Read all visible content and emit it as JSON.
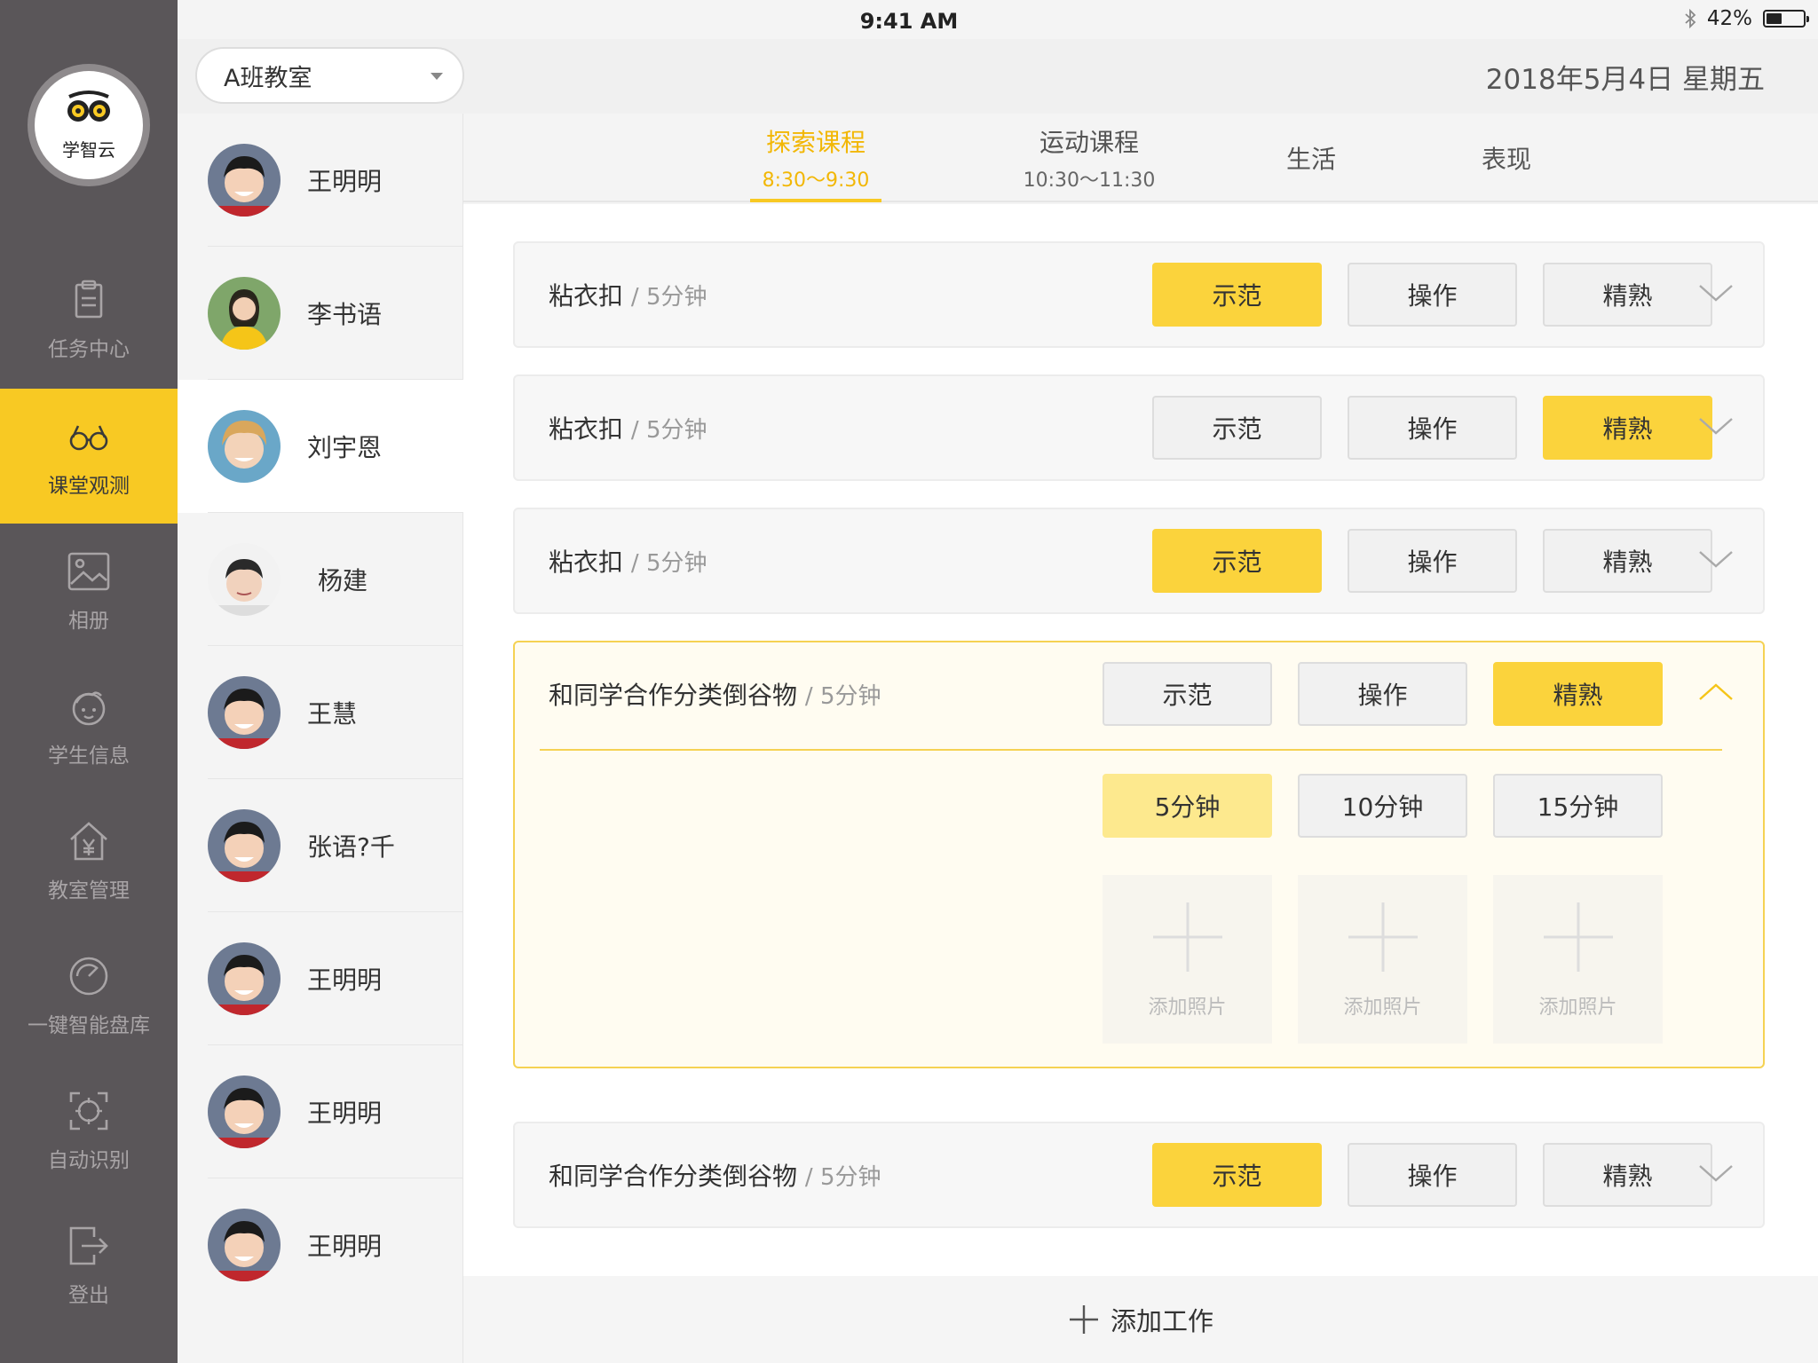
{
  "status_bar": {
    "device": "iPad",
    "time": "9:41 AM",
    "battery": "42%",
    "battery_level": 0.42
  },
  "app": {
    "logo_text": "学智云"
  },
  "nav": [
    {
      "label": "任务中心",
      "icon": "clipboard-icon",
      "active": false
    },
    {
      "label": "课堂观测",
      "icon": "glasses-icon",
      "active": true
    },
    {
      "label": "相册",
      "icon": "photo-icon",
      "active": false
    },
    {
      "label": "学生信息",
      "icon": "child-face-icon",
      "active": false
    },
    {
      "label": "教室管理",
      "icon": "house-yen-icon",
      "active": false
    },
    {
      "label": "一键智能盘库",
      "icon": "gauge-icon",
      "active": false
    },
    {
      "label": "自动识别",
      "icon": "scan-icon",
      "active": false
    },
    {
      "label": "登出",
      "icon": "logout-icon",
      "active": false
    }
  ],
  "header": {
    "classroom": "A班教室",
    "date": "2018年5月4日 星期五"
  },
  "students": [
    {
      "name": "王明明"
    },
    {
      "name": "李书语"
    },
    {
      "name": "刘宇恩"
    },
    {
      "name": "杨建"
    },
    {
      "name": "王慧"
    },
    {
      "name": "张语?千"
    },
    {
      "name": "王明明"
    },
    {
      "name": "王明明"
    },
    {
      "name": "王明明"
    }
  ],
  "tabs": [
    {
      "label": "探索课程",
      "time": "8:30～9:30",
      "active": true
    },
    {
      "label": "运动课程",
      "time": "10:30～11:30",
      "active": false
    },
    {
      "label": "生活",
      "time": "",
      "active": false
    },
    {
      "label": "表现",
      "time": "",
      "active": false
    }
  ],
  "levels": [
    "示范",
    "操作",
    "精熟"
  ],
  "activities": [
    {
      "name": "粘衣扣",
      "duration": "/ 5分钟",
      "selected": "示范"
    },
    {
      "name": "粘衣扣",
      "duration": "/ 5分钟",
      "selected": "精熟"
    },
    {
      "name": "粘衣扣",
      "duration": "/ 5分钟",
      "selected": "示范"
    },
    {
      "name": "和同学合作分类倒谷物",
      "duration": "/ 5分钟",
      "selected": "精熟",
      "expanded": true,
      "duration_options": [
        "5分钟",
        "10分钟",
        "15分钟"
      ],
      "selected_duration": "5分钟",
      "photo_slots": [
        "添加照片",
        "添加照片",
        "添加照片"
      ]
    },
    {
      "name": "和同学合作分类倒谷物",
      "duration": "/ 5分钟",
      "selected": "示范"
    }
  ],
  "add_work_label": "添加工作",
  "colors": {
    "accent": "#f8c923",
    "nav_bg": "#5a5659",
    "tab_active": "#f2b705"
  }
}
